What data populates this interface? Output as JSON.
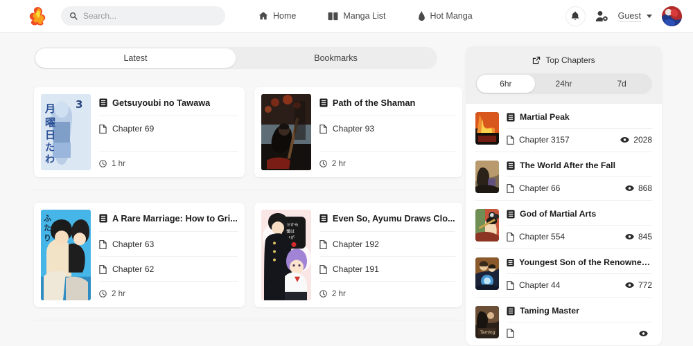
{
  "header": {
    "logo_icon": "phoenix-logo",
    "search": {
      "placeholder": "Search...",
      "value": "",
      "icon": "search-icon"
    },
    "nav": [
      {
        "label": "Home",
        "icon": "home-icon"
      },
      {
        "label": "Manga List",
        "icon": "book-open-icon"
      },
      {
        "label": "Hot Manga",
        "icon": "flame-icon"
      }
    ],
    "bell_icon": "bell-icon",
    "user_gear_icon": "user-gear-icon",
    "user_label": "Guest",
    "avatar_icon": "user-avatar"
  },
  "main": {
    "tabs": [
      {
        "label": "Latest",
        "active": true
      },
      {
        "label": "Bookmarks",
        "active": false
      }
    ],
    "cards": [
      {
        "title": "Getsuyoubi no Tawawa",
        "chapters": [
          "Chapter 69"
        ],
        "time": "1 hr",
        "cover": "cover-getsuyoubi"
      },
      {
        "title": "Path of the Shaman",
        "chapters": [
          "Chapter 93"
        ],
        "time": "2 hr",
        "cover": "cover-shaman"
      },
      {
        "title": "A Rare Marriage: How to Gri...",
        "chapters": [
          "Chapter 63",
          "Chapter 62"
        ],
        "time": "2 hr",
        "cover": "cover-rare-marriage"
      },
      {
        "title": "Even So, Ayumu Draws Clo...",
        "chapters": [
          "Chapter 192",
          "Chapter 191"
        ],
        "time": "2 hr",
        "cover": "cover-ayumu"
      }
    ],
    "icons": {
      "title": "book-icon",
      "chapter": "page-icon",
      "time": "clock-icon"
    }
  },
  "sidebar": {
    "panel_title": "Top Chapters",
    "panel_title_icon": "external-link-icon",
    "segments": [
      {
        "label": "6hr",
        "active": true
      },
      {
        "label": "24hr",
        "active": false
      },
      {
        "label": "7d",
        "active": false
      }
    ],
    "eye_icon": "eye-icon",
    "items": [
      {
        "title": "Martial Peak",
        "chapter": "Chapter 3157",
        "views": "2028",
        "cover": "cover-martial-peak"
      },
      {
        "title": "The World After the Fall",
        "chapter": "Chapter 66",
        "views": "868",
        "cover": "cover-world-after-fall"
      },
      {
        "title": "God of Martial Arts",
        "chapter": "Chapter 554",
        "views": "845",
        "cover": "cover-god-martial-arts"
      },
      {
        "title": "Youngest Son of the Renowned M...",
        "chapter": "Chapter 44",
        "views": "772",
        "cover": "cover-youngest-son"
      },
      {
        "title": "Taming Master",
        "chapter": "",
        "views": "",
        "cover": "cover-taming-master"
      }
    ]
  },
  "colors": {
    "page_bg": "#f7f7f7",
    "header_bg": "#ffffff",
    "card_bg": "#ffffff",
    "accent": "#f4541f",
    "muted": "#9b9b9b"
  }
}
